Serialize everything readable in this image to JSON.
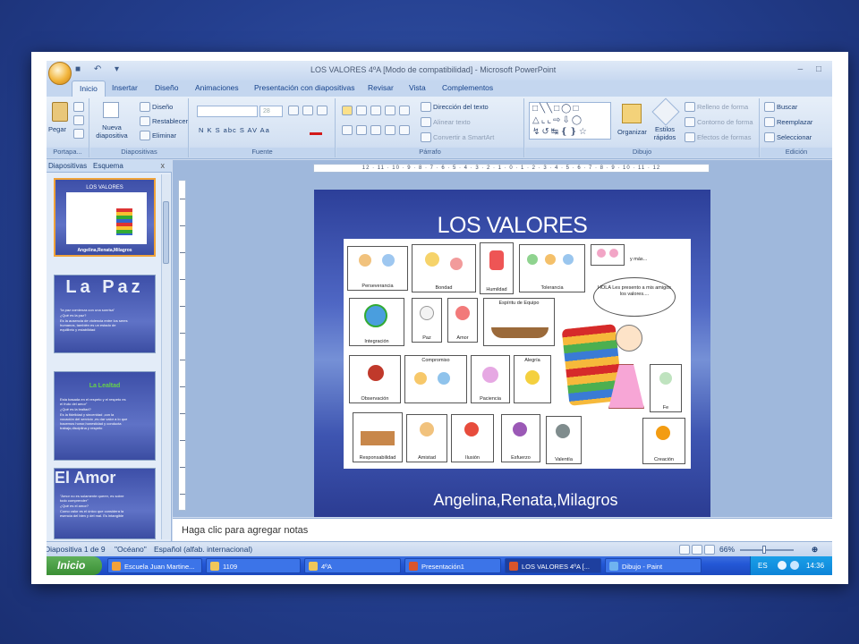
{
  "window": {
    "title": "LOS VALORES  4ºA [Modo de compatibilidad] - Microsoft PowerPoint",
    "controls": "–  □"
  },
  "tabs": [
    "Inicio",
    "Insertar",
    "Diseño",
    "Animaciones",
    "Presentación con diapositivas",
    "Revisar",
    "Vista",
    "Complementos"
  ],
  "ribbon": {
    "clipboard": {
      "label": "Portapa...",
      "paste": "Pegar"
    },
    "slides": {
      "label": "Diapositivas",
      "new_slide": "Nueva diapositiva",
      "layout": "Diseño",
      "reset": "Restablecer",
      "delete": "Eliminar"
    },
    "font": {
      "label": "Fuente",
      "size": "28",
      "buttons": "N  K  S  abc  S  AV  Aa"
    },
    "paragraph": {
      "label": "Párrafo",
      "text_direction": "Dirección del texto",
      "align_text": "Alinear texto",
      "smartart": "Convertir a SmartArt"
    },
    "drawing": {
      "label": "Dibujo",
      "arrange": "Organizar",
      "quick_styles": "Estilos rápidos",
      "shape_fill": "Relleno de forma",
      "shape_outline": "Contorno de forma",
      "shape_effects": "Efectos de formas"
    },
    "editing": {
      "label": "Edición",
      "find": "Buscar",
      "replace": "Reemplazar",
      "select": "Seleccionar"
    }
  },
  "panel": {
    "tab_slides": "Diapositivas",
    "tab_outline": "Esquema",
    "close": "x",
    "thumbnails": [
      {
        "title": "LOS VALORES",
        "caption": "Angelina,Renata,Milagros"
      },
      {
        "title": "La Paz",
        "lines": [
          "\"la paz comienza con una sonrisa\"",
          "¿Qué es la paz?",
          "Es la ausencia de violencia entre los seres",
          "humanos, también es un estado de",
          "equilibrio y estabilidad"
        ]
      },
      {
        "title": "La Lealtad",
        "lines": [
          "Esta basada en el respeto y el respeto es",
          "el fruto del amor\"",
          "¿Qué es la lealtad?",
          "Es la fidelidad y sinceridad ,con la",
          "vocación del servicio ,es dar valor a lo que",
          "hacemos honor,honestidad y conducta",
          "trabajo,disciplina y respeto"
        ]
      },
      {
        "title": "El Amor",
        "lines": [
          "\"Amor no es solamente querer, es sobre",
          "todo comprender\"",
          "¿Qué es el amor?",
          "Como valor es el único que considera la",
          "esencia del bien y del mal. Es intangible"
        ]
      }
    ]
  },
  "ruler_text": "12 · 11 · 10 · 9 · 8 · 7 · 6 · 5 · 4 · 3 · 2 · 1 · 0 · 1 · 2 · 3 · 4 · 5 · 6 · 7 · 8 · 9 · 10 · 11 · 12",
  "slide": {
    "title": "LOS VALORES",
    "subtitle": "Angelina,Renata,Milagros",
    "cloud_text": "HOLA Les presento a mis amigos los valores....",
    "extra_text": "y más...",
    "cards": [
      "Perseverancia",
      "Bondad",
      "Humildad",
      "Tolerancia",
      "Integración",
      "Paz",
      "Amor",
      "Espíritu de Equipo",
      "Observación",
      "Compromiso",
      "Paciencia",
      "Alegría",
      "Fe",
      "Responsabilidad",
      "Amistad",
      "Ilusión",
      "Esfuerzo",
      "Valentía",
      "Creación"
    ]
  },
  "notes_placeholder": "Haga clic para agregar notas",
  "status": {
    "slide_count": "Diapositiva 1 de 9",
    "theme": "\"Océano\"",
    "language": "Español (alfab. internacional)",
    "zoom": "66%"
  },
  "taskbar": {
    "start": "Inicio",
    "items": [
      "Escuela Juan Martine...",
      "1109",
      "4ºA",
      "Presentación1",
      "LOS VALORES  4ºA [...",
      "Dibujo - Paint"
    ],
    "lang": "ES",
    "clock": "14:36"
  }
}
